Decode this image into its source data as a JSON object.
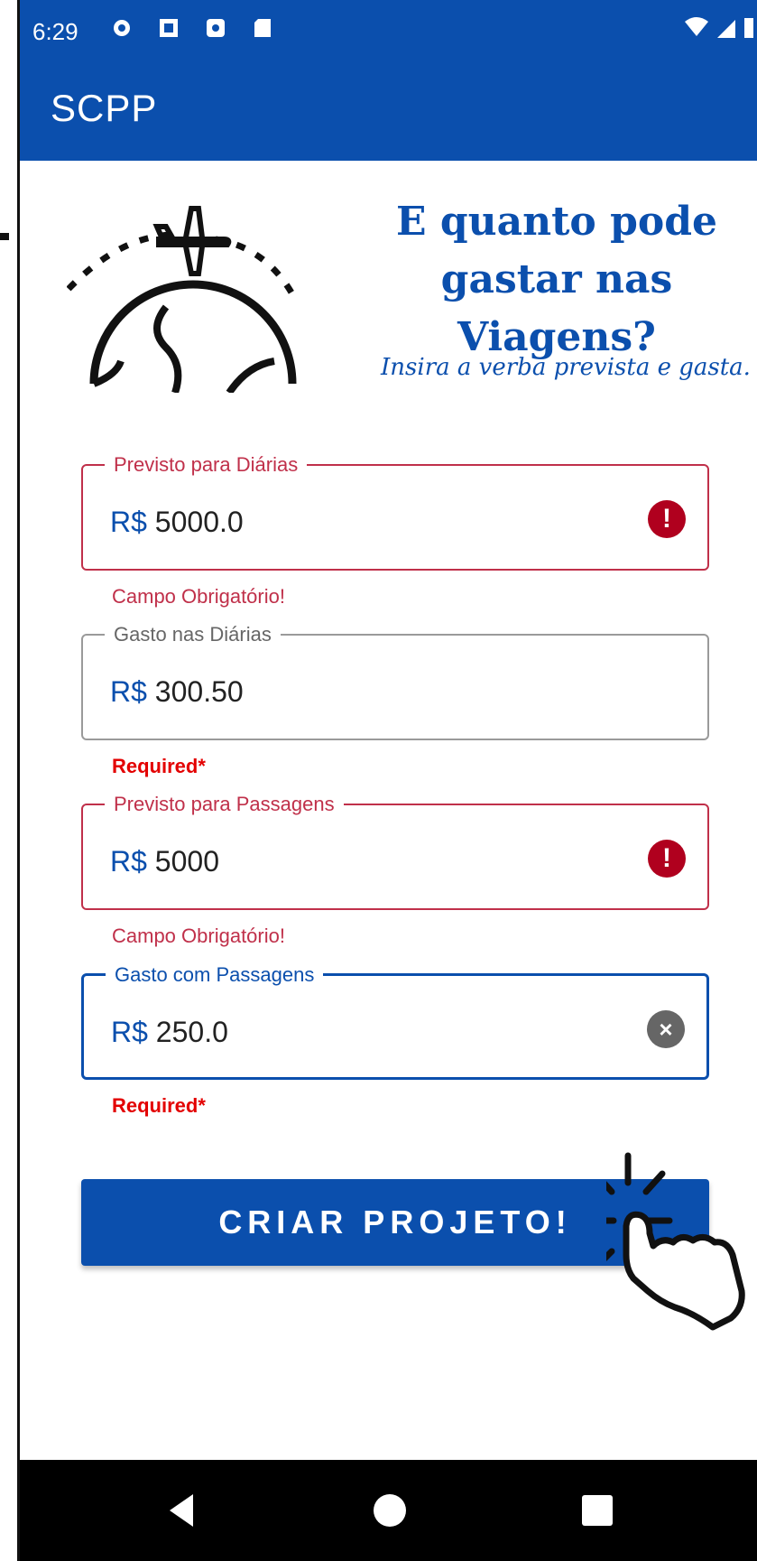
{
  "status_bar": {
    "time": "6:29",
    "left_icons": [
      "gear-icon",
      "image-icon",
      "shield-icon",
      "sd-card-icon"
    ],
    "right_icons": [
      "wifi-icon",
      "signal-icon",
      "battery-icon"
    ]
  },
  "app_bar": {
    "title": "SCPP"
  },
  "hero": {
    "title_line1": "E quanto pode",
    "title_line2": "gastar nas Viagens?",
    "subtitle": "Insira a verba prevista e gasta.",
    "illustration": "plane-around-globe-icon"
  },
  "fields": [
    {
      "label": "Previsto para Diárias",
      "currency": "R$",
      "value": "5000.0",
      "state": "error",
      "icon": "error-icon",
      "helper": "Campo Obrigatório!"
    },
    {
      "label": "Gasto nas Diárias",
      "currency": "R$",
      "value": "300.50",
      "state": "neutral",
      "helper": "Required*"
    },
    {
      "label": "Previsto para Passagens",
      "currency": "R$",
      "value": "5000",
      "state": "error",
      "icon": "error-icon",
      "helper": "Campo Obrigatório!"
    },
    {
      "label": "Gasto com Passagens",
      "currency": "R$",
      "value": "250.0",
      "state": "focused",
      "icon": "clear-icon",
      "helper": "Required*"
    }
  ],
  "cta": {
    "label": "CRIAR PROJETO!"
  },
  "nav": {
    "items": [
      "back-icon",
      "home-icon",
      "recents-icon"
    ]
  },
  "colors": {
    "primary": "#0b4fad",
    "error": "#c0304a",
    "required": "#e30000"
  }
}
